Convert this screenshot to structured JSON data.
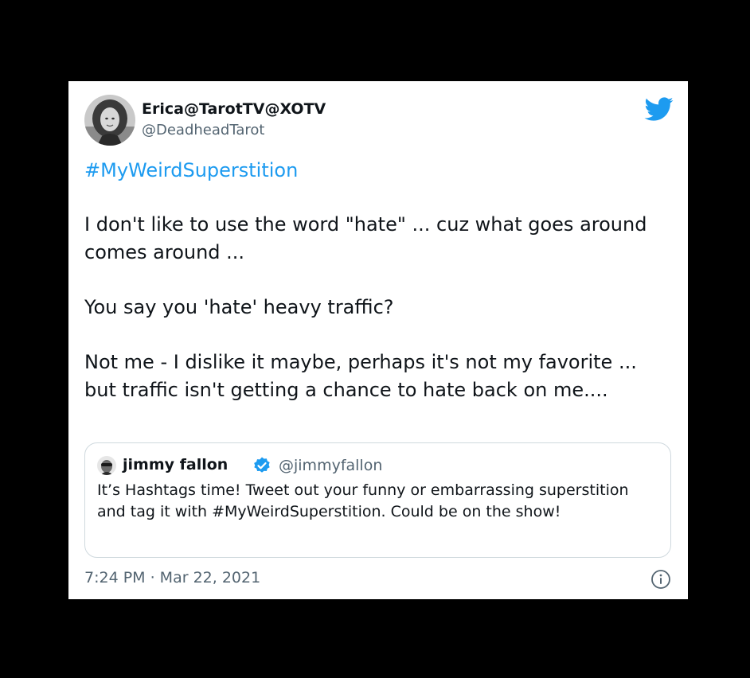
{
  "tweet": {
    "author": {
      "display_name": "Erica@TarotTV@XOTV",
      "handle": "@DeadheadTarot"
    },
    "hashtag": "#MyWeirdSuperstition",
    "paragraphs": [
      "I don't like to use the word \"hate\" ... cuz what goes around comes around ...",
      "You say you 'hate' heavy traffic?",
      "Not me - I dislike it maybe, perhaps it's not my favorite ... but traffic isn't getting a chance to hate back on me...."
    ],
    "quoted_tweet": {
      "display_name": "jimmy fallon",
      "handle": "@jimmyfallon",
      "verified": true,
      "text": "It’s Hashtags time! Tweet out your funny or embarrassing superstition and tag it with #MyWeirdSuperstition. Could be on the show!"
    },
    "timestamp": "7:24 PM · Mar 22, 2021"
  },
  "icons": {
    "brand": "twitter-bird-icon",
    "verified": "verified-badge-icon",
    "info": "info-icon"
  },
  "colors": {
    "background": "#000000",
    "card": "#ffffff",
    "text_primary": "#0f1419",
    "text_secondary": "#536471",
    "accent": "#1d9bf0",
    "quote_border": "#cfd9de"
  }
}
